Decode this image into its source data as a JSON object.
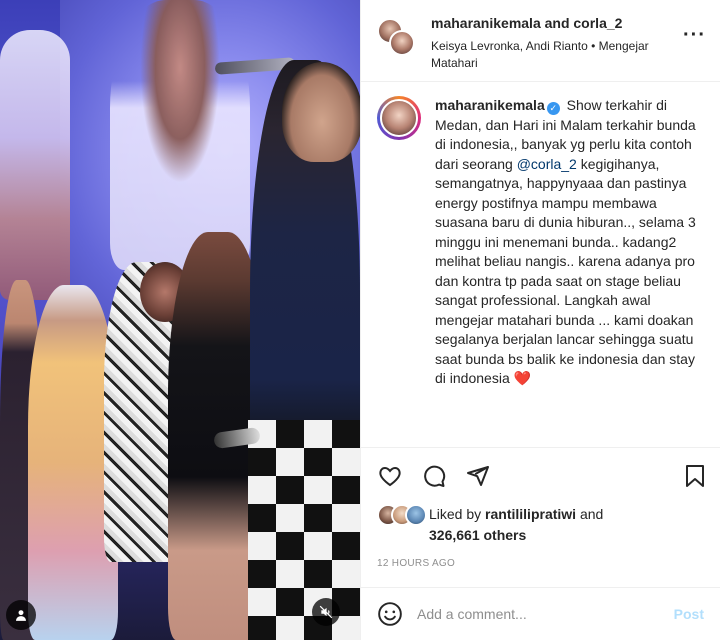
{
  "header": {
    "title": "maharanikemala and corla_2",
    "subtitle": "Keisya Levronka, Andi Rianto • Mengejar Matahari",
    "more_icon": "more-horizontal-icon"
  },
  "caption": {
    "username": "maharanikemala",
    "verified": true,
    "text_before_mention": "Show terkahir di Medan, dan Hari ini Malam terkahir bunda di indonesia,, banyak yg perlu kita contoh dari seorang",
    "mention": "@corla_2",
    "text_after_mention": "kegigihanya, semangatnya, happynyaaa dan pastinya energy postifnya mampu membawa suasana baru di dunia hiburan.., selama 3 minggu ini menemani bunda.. kadang2 melihat beliau nangis.. karena adanya pro dan kontra tp pada saat on stage beliau sangat professional. Langkah awal mengejar matahari bunda ... kami doakan segalanya berjalan lancar sehingga suatu saat bunda bs balik ke indonesia dan stay di indonesia",
    "emoji": "❤️"
  },
  "actions": {
    "like_icon": "heart-icon",
    "comment_icon": "comment-icon",
    "share_icon": "share-icon",
    "save_icon": "bookmark-icon"
  },
  "likes": {
    "prefix": "Liked by",
    "user": "rantililipratiwi",
    "and": "and",
    "count": "326,661 others"
  },
  "timestamp": "12 HOURS AGO",
  "comment": {
    "placeholder": "Add a comment...",
    "post_label": "Post",
    "emoji_icon": "smiley-icon"
  },
  "media": {
    "tag_icon": "user-tag-icon",
    "mute_icon": "muted-speaker-icon"
  },
  "colors": {
    "link": "#00376b",
    "verified": "#3897f0",
    "heart": "#ed4956",
    "post_disabled": "#b2dffc",
    "muted_text": "#8e8e8e"
  }
}
